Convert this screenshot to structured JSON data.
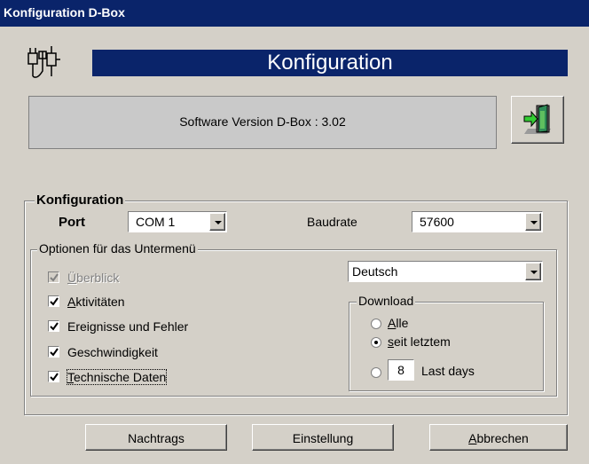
{
  "window": {
    "title": "Konfiguration D-Box"
  },
  "header": {
    "banner": "Konfiguration",
    "icon": "device-icon"
  },
  "version": {
    "text": "Software Version D-Box : 3.02"
  },
  "exit_icon": "exit-door-icon",
  "config": {
    "group_title": "Konfiguration",
    "port_label": "Port",
    "port_value": "COM 1",
    "baud_label": "Baudrate",
    "baud_value": "57600"
  },
  "options": {
    "group_title": "Optionen für das Untermenü",
    "items": [
      {
        "first": "Ü",
        "rest": "berblick",
        "checked": true,
        "disabled": true
      },
      {
        "first": "A",
        "rest": "ktivitäten",
        "checked": true,
        "disabled": false
      },
      {
        "first": "",
        "rest": "Ereignisse und Fehler",
        "checked": true,
        "disabled": false
      },
      {
        "first": "",
        "rest": "Geschwindigkeit",
        "checked": true,
        "disabled": false
      },
      {
        "first": "T",
        "rest": "echnische Daten",
        "checked": true,
        "disabled": false
      }
    ],
    "language_value": "Deutsch"
  },
  "download": {
    "group_title": "Download",
    "alle_first": "A",
    "alle_rest": "lle",
    "seit_first": "s",
    "seit_rest": "eit letztem",
    "days_value": "8",
    "days_label": "Last days",
    "selected": "seit letztem"
  },
  "buttons": {
    "nachtrags": "Nachtrags",
    "einstellung": "Einstellung",
    "abbrechen_first": "A",
    "abbrechen_rest": "bbrechen"
  }
}
